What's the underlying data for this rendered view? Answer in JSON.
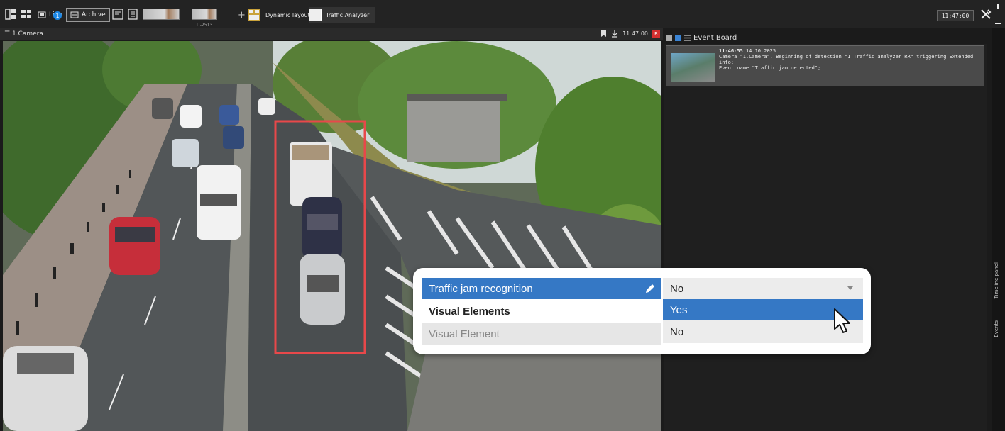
{
  "toolbar": {
    "live_label": "Live",
    "live_badge": "1",
    "archive_label": "Archive",
    "thumb_label": "IT-2513",
    "add_label": "+",
    "layouts": [
      {
        "label": "Dynamic layout"
      },
      {
        "label": "Traffic Analyzer"
      }
    ],
    "clock": "11:47:00"
  },
  "camera": {
    "name": "1.Camera",
    "time": "11:47:00",
    "rec_badge": "R"
  },
  "event_board": {
    "title": "Event Board",
    "events": [
      {
        "time": "11:46:55",
        "date": "14.10.2025",
        "line1": "Camera \"1.Camera\". Beginning of detection \"1.Traffic analyzer RR\" triggering Extended info:",
        "line2": "Event name \"Traffic jam detected\";"
      }
    ]
  },
  "side_tabs": {
    "timeline": "Timeline panel",
    "events": "Events"
  },
  "popup": {
    "property": "Traffic jam recognition",
    "section": "Visual Elements",
    "sub": "Visual Element",
    "value": "No",
    "options": [
      "Yes",
      "No"
    ]
  },
  "colors": {
    "selection_blue": "#3578c5",
    "detection_box": "#e8484a",
    "rec_red": "#d32f2f"
  }
}
